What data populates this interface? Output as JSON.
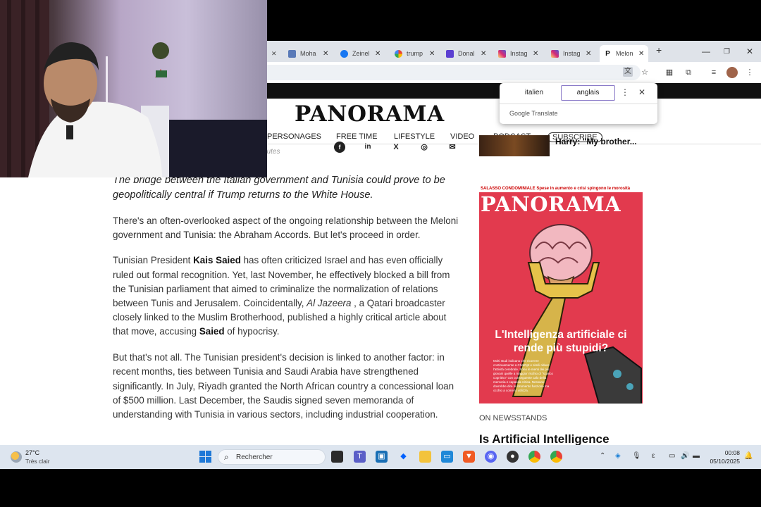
{
  "browser": {
    "tabs": [
      {
        "label": "Moha",
        "icon": "tab-favicon-generic",
        "color": "#5a7ab8"
      },
      {
        "label": "Zeinel",
        "icon": "facebook-icon",
        "color": "#1877f2"
      },
      {
        "label": "trump",
        "icon": "google-icon",
        "color": "#ea4335"
      },
      {
        "label": "Donal",
        "icon": "tab-favicon-t",
        "color": "#5b3fd1"
      },
      {
        "label": "Instag",
        "icon": "instagram-icon",
        "color": "#d62976"
      },
      {
        "label": "Instag",
        "icon": "instagram-icon",
        "color": "#d62976"
      },
      {
        "label": "Melon",
        "icon": "panorama-favicon",
        "color": "#111111"
      }
    ],
    "new_tab": "+",
    "close_glyph": "✕"
  },
  "translate": {
    "source_lang": "italien",
    "target_lang": "anglais",
    "brand": "Google Translate"
  },
  "site": {
    "logo": "PANORAMA",
    "nav": [
      "PERSONAGES",
      "FREE TIME",
      "LIFESTYLE",
      "VIDEO",
      "PODCAST",
      "SUBSCRIBE"
    ],
    "minutes": "nutes",
    "sidebar_caption": "Harry: \"My brother...",
    "newsstands": "ON NEWSSTANDS",
    "sidebar_title": "Is Artificial Intelligence"
  },
  "article": {
    "lede": "The bridge between the Italian government and Tunisia could prove to be geopolitically central if Trump returns to the White House.",
    "p1": "There's an often-overlooked aspect of the ongoing relationship between the Meloni government and Tunisia: the Abraham Accords. But let's proceed in order.",
    "p2_a": "Tunisian President ",
    "p2_b": "Kais Saied",
    "p2_c": " has often criticized Israel and has even officially ruled out formal recognition. Yet, last November, he effectively blocked a bill from the Tunisian parliament that aimed to criminalize the normalization of relations between Tunis and Jerusalem. Coincidentally, ",
    "p2_d": "Al Jazeera",
    "p2_e": " , a Qatari broadcaster closely linked to the Muslim Brotherhood, published a highly critical article about that move, accusing ",
    "p2_f": "Saied",
    "p2_g": " of hypocrisy.",
    "p3": "But that's not all. The Tunisian president's decision is linked to another factor: in recent months, ties between Tunisia and Saudi Arabia have strengthened significantly. In July, Riyadh granted the North African country a concessional loan of $500 million. Last December, the Saudis signed seven memoranda of understanding with Tunisia in various sectors, including industrial cooperation."
  },
  "cover": {
    "topline": "SALASSO CONDOMINIALE Spese in aumento e crisi spingono le morosità",
    "logo": "PANORAMA",
    "headline": "L'Intelligenza artificiale ci rende più stupidi?",
    "body": "Molti studi indicano che ricorrere continuamente a ChatGpt e simili riduce l'attività cerebrale. Sono le menti dei più giovani quelle a maggior rischio di \"scarico cognitivo\" con conseguente calo della memoria e capacità critica. Nessuno dovrebbe dire lo strumento funziona ma occhio a come lo utilizza."
  },
  "taskbar": {
    "temperature": "27°C",
    "weather": "Très clair",
    "search_placeholder": "Rechercher",
    "time": "00:08",
    "date": "05/10/2025"
  },
  "colors": {
    "cover_red": "#e23a4e",
    "taskbar": "#dde5ef",
    "tabbar": "#dfe3e9"
  }
}
